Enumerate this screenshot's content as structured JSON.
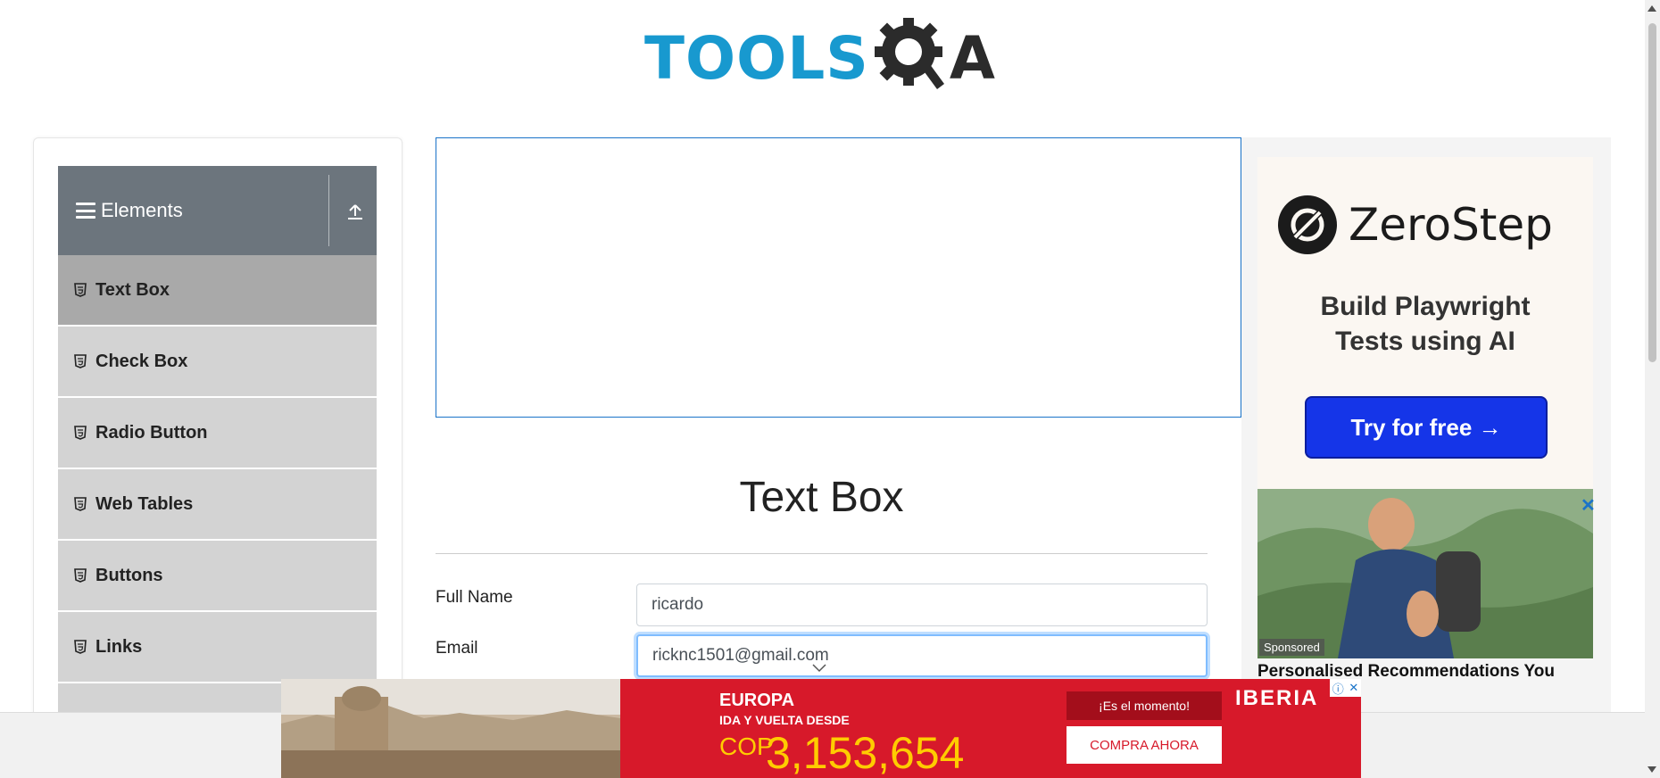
{
  "header": {
    "logo_main": "TOOLS",
    "logo_tail": "A"
  },
  "sidebar": {
    "group_title": "Elements",
    "items": [
      {
        "label": "Text Box"
      },
      {
        "label": "Check Box"
      },
      {
        "label": "Radio Button"
      },
      {
        "label": "Web Tables"
      },
      {
        "label": "Buttons"
      },
      {
        "label": "Links"
      }
    ]
  },
  "main": {
    "title": "Text Box",
    "full_name_label": "Full Name",
    "full_name_value": "ricardo",
    "email_label": "Email",
    "email_value": "ricknc1501@gmail.com"
  },
  "right_ad": {
    "brand": "ZeroStep",
    "headline_line1": "Build Playwright",
    "headline_line2": "Tests using AI",
    "cta": "Try for free →",
    "close": "✕",
    "sponsored": "Sponsored",
    "ad2_title": "Personalised Recommendations You"
  },
  "bottom_ad": {
    "destination": "EUROPA",
    "subtitle": "IDA Y VUELTA DESDE",
    "currency": "COP",
    "price": "3,153,654",
    "moment": "¡Es el momento!",
    "buy": "COMPRA AHORA",
    "brand": "IBERIA",
    "choice_info": "ⓘ",
    "choice_close": "✕"
  },
  "colors": {
    "brand_blue": "#1899cf",
    "sidebar_header": "#6c757d",
    "sidebar_item": "#d3d3d3",
    "sidebar_item_active": "#a9a9a9",
    "zerostep_button": "#1535e8",
    "iberia_red": "#d7192a"
  }
}
